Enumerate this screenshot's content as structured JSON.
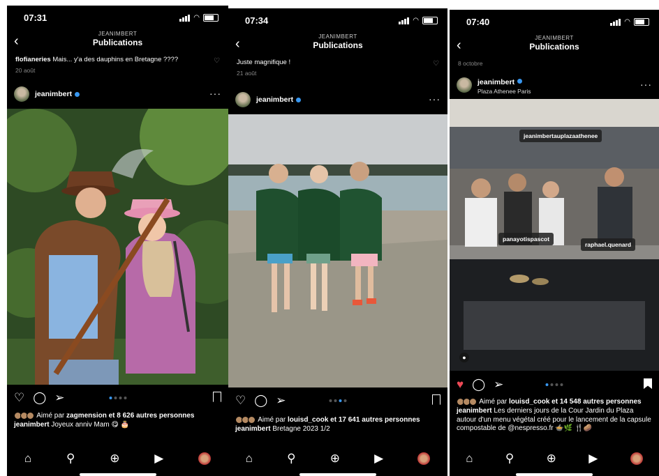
{
  "status_times": [
    "07:31",
    "07:34",
    "07:40"
  ],
  "header": {
    "username": "JEANIMBERT",
    "title": "Publications"
  },
  "posts": [
    {
      "comment_user": "flofianeries",
      "comment_text": "Mais... y'a des dauphins en Bretagne ????",
      "comment_date": "20 août",
      "author": "jeanimbert",
      "liked_by": "zagmension",
      "likes_rest": "et 8 626 autres personnes",
      "caption_text": "Joyeux anniv Mam 😋 🎂"
    },
    {
      "comment_text_partial": "Juste magnifique !",
      "comment_date": "21 août",
      "author": "jeanimbert",
      "liked_by": "louisd_cook",
      "likes_rest": "et 17 641 autres personnes",
      "caption_text": "Bretagne 2023 1/2"
    },
    {
      "comment_date": "8 octobre",
      "author": "jeanimbert",
      "location": "Plaza Athenee Paris",
      "tags": [
        "jeanimbertauplazaathenee",
        "panayotispascot",
        "raphael.quenard"
      ],
      "liked_by": "louisd_cook",
      "likes_rest": "et 14 548 autres personnes",
      "caption_text": "Les derniers jours de la Cour Jardin du Plaza autour d'un menu végétal créé pour le lancement de la capsule compostable de @nespresso.fr 🍲🌿 🍴🥔"
    }
  ],
  "labels": {
    "liked_prefix": "Aimé par"
  },
  "colors": {
    "accent": "#3897f0",
    "liked": "#ed4956",
    "background": "#000000"
  }
}
